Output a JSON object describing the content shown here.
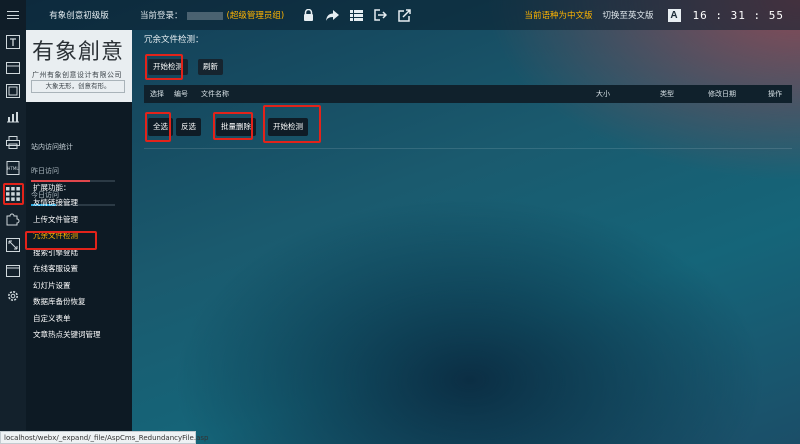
{
  "topbar": {
    "app_title": "有象创意初级版",
    "login_label": "当前登录：",
    "role": "(超级管理员组)",
    "current_language": "当前语种为中文版",
    "switch_language": "切换至英文版",
    "font_size_label": "A",
    "clock": "16 : 31 : 55"
  },
  "logo": {
    "title": "有象創意",
    "subtitle": "广州有象创意设计有限公司",
    "slogan": "大象无形，创意有形。"
  },
  "stats": {
    "title": "站内访问统计",
    "yesterday": "昨日访问",
    "today": "今日访问",
    "yesterday_level": 0.7,
    "today_level": 0.3,
    "yesterday_color": "#e0474c",
    "today_color": "#2aa9e0"
  },
  "ext": {
    "title": "扩展功能：",
    "items": [
      {
        "label": "友情链接管理"
      },
      {
        "label": "上传文件管理"
      },
      {
        "label": "冗余文件检测"
      },
      {
        "label": "搜索引擎登陆"
      },
      {
        "label": "在线客服设置"
      },
      {
        "label": "幻灯片设置"
      },
      {
        "label": "数据库备份恢复"
      },
      {
        "label": "自定义表单"
      },
      {
        "label": "文章热点关键词管理"
      }
    ]
  },
  "main": {
    "page_title": "冗余文件检测：",
    "start_check": "开始检测",
    "refresh": "刷新",
    "columns": {
      "select": "选择",
      "number": "编号",
      "filename": "文件名称",
      "size": "大小",
      "type": "类型",
      "modified": "修改日期",
      "action": "操作"
    },
    "select_all": "全选",
    "invert": "反选",
    "batch_delete": "批量删除",
    "start_check_bottom": "开始检测"
  },
  "statusbar": {
    "url": "localhost/webx/_expand/_file/AspCms_RedundancyFile.asp"
  },
  "colors": {
    "highlight": "#e2231a",
    "accent": "#ffb400"
  }
}
